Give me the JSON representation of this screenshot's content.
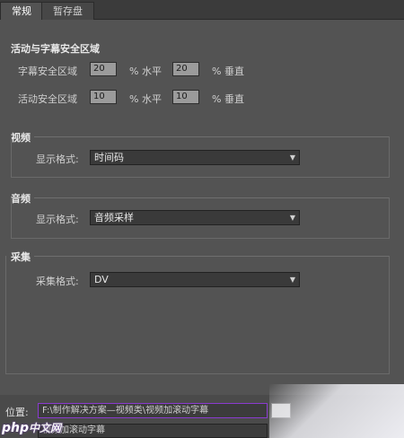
{
  "tabs": [
    {
      "label": "常规",
      "active": true
    },
    {
      "label": "暂存盘",
      "active": false
    }
  ],
  "safe_margins": {
    "title": "活动与字幕安全区域",
    "title_safe": {
      "label": "字幕安全区域",
      "h_value": "20",
      "h_unit": "% 水平",
      "v_value": "20",
      "v_unit": "% 垂直"
    },
    "action_safe": {
      "label": "活动安全区域",
      "h_value": "10",
      "h_unit": "% 水平",
      "v_value": "10",
      "v_unit": "% 垂直"
    }
  },
  "video": {
    "title": "视频",
    "label": "显示格式:",
    "value": "时间码"
  },
  "audio": {
    "title": "音频",
    "label": "显示格式:",
    "value": "音频采样"
  },
  "capture": {
    "title": "采集",
    "label": "采集格式:",
    "value": "DV"
  },
  "location": {
    "label": "位置:",
    "value": "F:\\制作解决方案—视频类\\视频加滚动字幕"
  },
  "name_field": {
    "value": "视频加滚动字幕"
  },
  "logo": {
    "text": "php",
    "zh": "中文网"
  },
  "colors": {
    "background": "#535353",
    "highlight_border": "#8b3bd0"
  }
}
